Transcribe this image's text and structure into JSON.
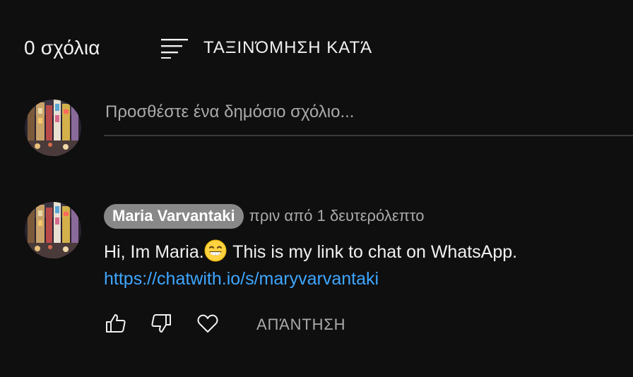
{
  "header": {
    "count_label": "0 σχόλια",
    "sort_label": "ΤΑΞΙΝΌΜΗΣΗ ΚΑΤΆ",
    "sort_icon": "sort-lines-icon"
  },
  "add_comment": {
    "placeholder": "Προσθέστε ένα δημόσιο σχόλιο..."
  },
  "comment": {
    "author": "Maria Varvantaki",
    "timestamp": "πριν από 1 δευτερόλεπτο",
    "text_before_emoji": "Hi, Im Maria.",
    "emoji": "grinning-face-with-smiling-eyes",
    "text_after_emoji": " This is my link to chat on WhatsApp.",
    "link": "https://chatwith.io/s/maryvarvantaki",
    "actions": {
      "like_icon": "thumbs-up-icon",
      "dislike_icon": "thumbs-down-icon",
      "heart_icon": "heart-icon",
      "reply_label": "ΑΠΆΝΤΗΣΗ"
    }
  },
  "colors": {
    "background": "#0f0f0f",
    "text_primary": "#f1f1f1",
    "text_secondary": "#aaaaaa",
    "link": "#3ea6ff",
    "author_chip_bg": "#888888",
    "divider": "#3a3a3a"
  }
}
